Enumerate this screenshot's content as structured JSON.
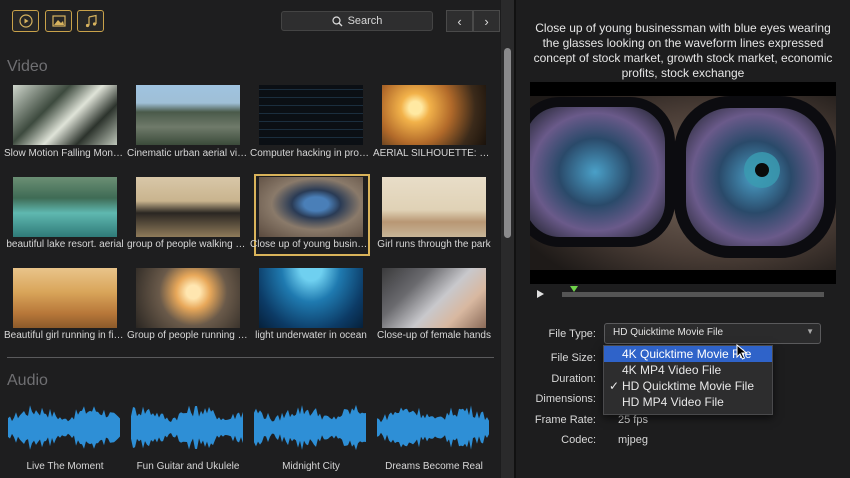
{
  "toolbar": {
    "search_label": "Search",
    "accent": "#c9a24a"
  },
  "sections": {
    "video_title": "Video",
    "audio_title": "Audio"
  },
  "videos": [
    {
      "caption": "Slow Motion Falling Money Bills"
    },
    {
      "caption": "Cinematic urban aerial view"
    },
    {
      "caption": "Computer hacking in progress"
    },
    {
      "caption": "AERIAL SILHOUETTE: woman"
    },
    {
      "caption": "beautiful lake resort. aerial"
    },
    {
      "caption": "group of people walking street"
    },
    {
      "caption": "Close up of young businessman"
    },
    {
      "caption": "Girl runs through the park"
    },
    {
      "caption": "Beautiful girl running in field"
    },
    {
      "caption": "Group of people running sunset"
    },
    {
      "caption": "light underwater in ocean"
    },
    {
      "caption": "Close-up of female hands"
    }
  ],
  "audio": [
    {
      "caption": "Live The Moment"
    },
    {
      "caption": "Fun Guitar and Ukulele"
    },
    {
      "caption": "Midnight City"
    },
    {
      "caption": "Dreams Become Real"
    }
  ],
  "detail": {
    "description": "Close up of young businessman with blue eyes wearing the glasses looking on the waveform lines expressed concept of stock market, growth stock market, economic profits, stock exchange",
    "labels": {
      "file_type": "File Type:",
      "file_size": "File Size:",
      "duration": "Duration:",
      "dimensions": "Dimensions:",
      "frame_rate": "Frame Rate:",
      "codec": "Codec:"
    },
    "file_type_value": "HD Quicktime Movie File",
    "frame_rate_value": "25 fps",
    "codec_value": "mjpeg",
    "options": [
      {
        "label": "4K Quicktime Movie File",
        "highlighted": true,
        "checked": false
      },
      {
        "label": "4K MP4 Video File",
        "highlighted": false,
        "checked": false
      },
      {
        "label": "HD Quicktime Movie File",
        "highlighted": false,
        "checked": true
      },
      {
        "label": "HD MP4 Video File",
        "highlighted": false,
        "checked": false
      }
    ],
    "check_mark": "✓",
    "highlight_color": "#2f63c9",
    "playhead_color": "#6fd34a"
  }
}
